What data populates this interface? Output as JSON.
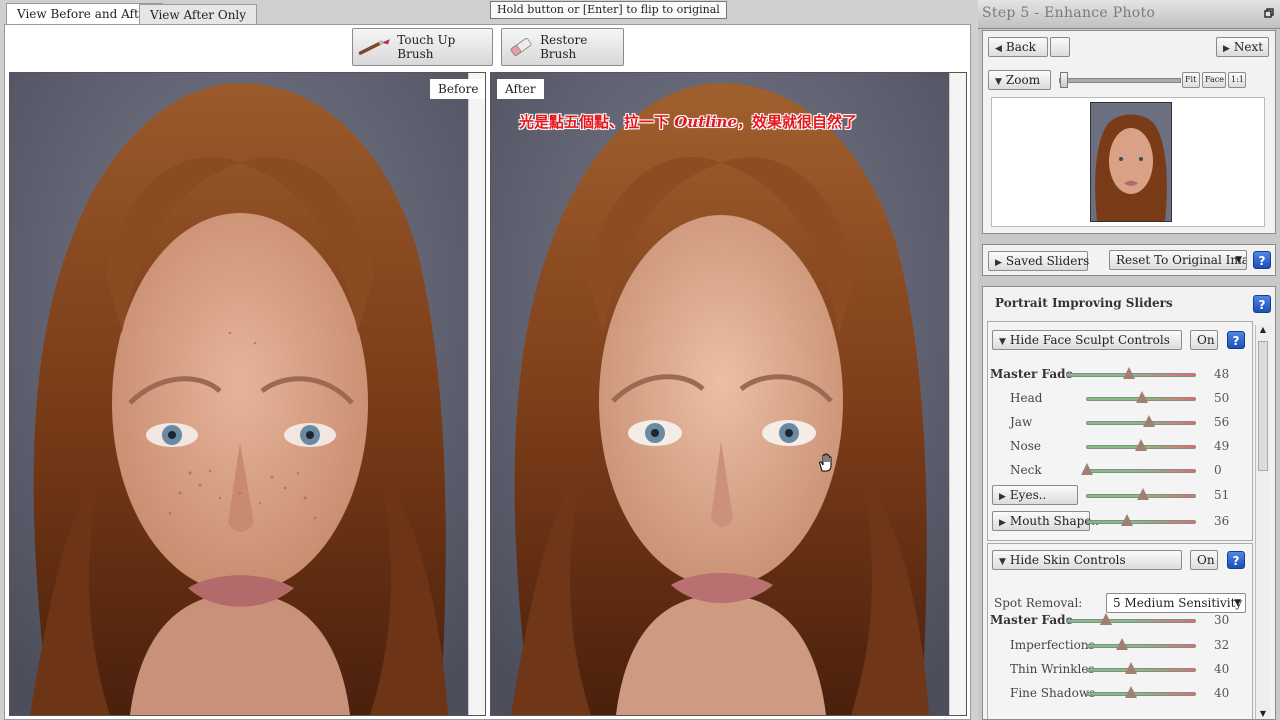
{
  "tabs": [
    {
      "label": "View Before and After",
      "active": true
    },
    {
      "label": "View After Only",
      "active": false
    }
  ],
  "hint": "Hold button or [Enter] to flip to original",
  "tools": {
    "touch_up": "Touch Up Brush",
    "restore": "Restore Brush"
  },
  "panes": {
    "before_label": "Before",
    "after_label": "After"
  },
  "caption": {
    "pre": "光是點五個點、拉一下 ",
    "em": "Outline",
    "post": "，效果就很自然了"
  },
  "right": {
    "title": "Step 5 - Enhance Photo",
    "back": "Back",
    "next": "Next",
    "zoom": {
      "label": "Zoom",
      "fit": "Fit",
      "face": "Face",
      "one": "1:1"
    },
    "saved_sliders": "Saved Sliders",
    "reset_select": "Reset To Original Image",
    "portrait_title": "Portrait Improving Sliders",
    "face_group": {
      "toggle": "Hide Face Sculpt Controls",
      "on": "On",
      "sliders": [
        {
          "label": "Master Fade",
          "value": 48,
          "bold": true
        },
        {
          "label": "Head",
          "value": 50
        },
        {
          "label": "Jaw",
          "value": 56
        },
        {
          "label": "Nose",
          "value": 49
        },
        {
          "label": "Neck",
          "value": 0
        },
        {
          "label": "Eyes..",
          "value": 51,
          "button": true
        },
        {
          "label": "Mouth Shape..",
          "value": 36,
          "button": true
        }
      ]
    },
    "skin_group": {
      "toggle": "Hide Skin Controls",
      "on": "On",
      "spot_label": "Spot Removal:",
      "spot_value": "5 Medium Sensitivity",
      "sliders": [
        {
          "label": "Master Fade",
          "value": 30,
          "bold": true
        },
        {
          "label": "Imperfections",
          "value": 32
        },
        {
          "label": "Thin Wrinkles",
          "value": 40
        },
        {
          "label": "Fine Shadows",
          "value": 40
        }
      ]
    }
  },
  "colors": {
    "caption": "#e8141c",
    "help": "#2a5cc8",
    "hair": "#8a4a22",
    "skin": "#d9a287",
    "backdrop": "#6d7081"
  }
}
